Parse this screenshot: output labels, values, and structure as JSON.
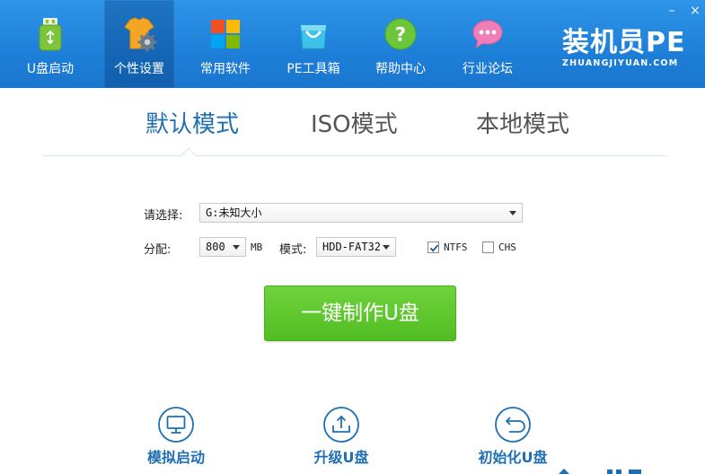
{
  "nav": {
    "items": [
      {
        "label": "U盘启动",
        "icon": "usb-drive-icon"
      },
      {
        "label": "个性设置",
        "icon": "tshirt-gear-icon"
      },
      {
        "label": "常用软件",
        "icon": "apps-grid-icon"
      },
      {
        "label": "PE工具箱",
        "icon": "shopping-bag-icon"
      },
      {
        "label": "帮助中心",
        "icon": "help-question-icon"
      },
      {
        "label": "行业论坛",
        "icon": "chat-bubble-icon"
      }
    ],
    "active_index": 1
  },
  "window": {
    "minimize_label": "–",
    "close_label": "×"
  },
  "logo": {
    "main": "装机员PE",
    "sub": "ZHUANGJIYUAN.COM"
  },
  "modes": {
    "tabs": [
      {
        "label": "默认模式"
      },
      {
        "label": "ISO模式"
      },
      {
        "label": "本地模式"
      }
    ],
    "active_index": 0
  },
  "form": {
    "select_label": "请选择:",
    "device_value": "G:未知大小",
    "alloc_label": "分配:",
    "alloc_value": "800",
    "alloc_unit": "MB",
    "mode_label": "模式:",
    "mode_value": "HDD-FAT32",
    "ntfs_label": "NTFS",
    "ntfs_checked": true,
    "chs_label": "CHS",
    "chs_checked": false
  },
  "make_button": "一键制作U盘",
  "bottom_actions": [
    {
      "label": "模拟启动",
      "icon": "monitor-icon"
    },
    {
      "label": "升级U盘",
      "icon": "upload-icon"
    },
    {
      "label": "初始化U盘",
      "icon": "undo-icon"
    }
  ],
  "colors": {
    "topbar": "#1e7fd8",
    "accent": "#1e6fb4",
    "make_button": "#5cc52c"
  }
}
